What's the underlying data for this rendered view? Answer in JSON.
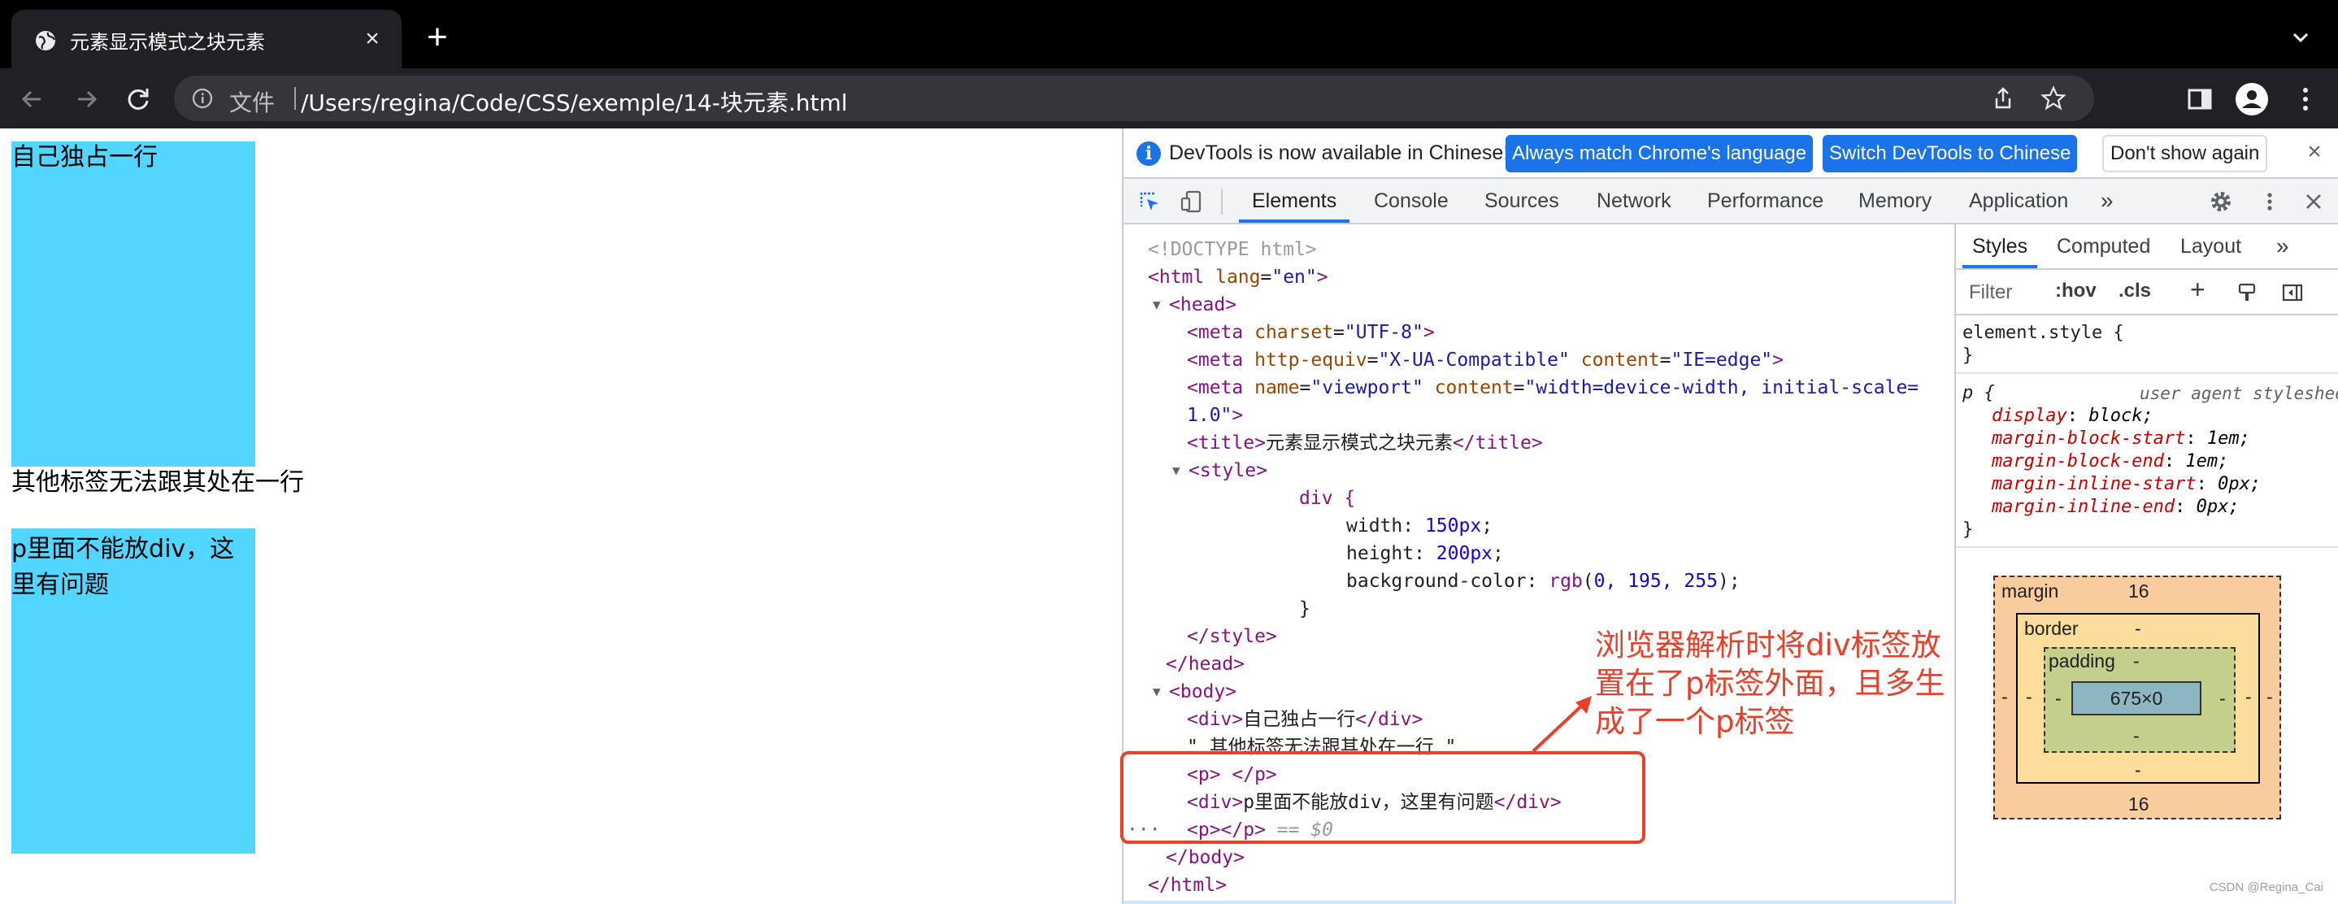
{
  "browser": {
    "tab_title": "元素显示模式之块元素",
    "omnibox_label": "文件",
    "url": "/Users/regina/Code/CSS/exemple/14-块元素.html"
  },
  "page": {
    "text1": "自己独占一行",
    "text2": "其他标签无法跟其处在一行",
    "text3_line1": "p里面不能放div，这",
    "text3_line2": "里有问题",
    "box_color": "#00c3ff"
  },
  "devtools": {
    "info_text": "DevTools is now available in Chinese!",
    "btn_match": "Always match Chrome's language",
    "btn_switch": "Switch DevTools to Chinese",
    "btn_dismiss": "Don't show again",
    "tabs": [
      "Elements",
      "Console",
      "Sources",
      "Network",
      "Performance",
      "Memory",
      "Application"
    ],
    "more": "»",
    "styles_tabs": [
      "Styles",
      "Computed",
      "Layout"
    ],
    "filter_placeholder": "Filter",
    "hov": ":hov",
    "cls": ".cls",
    "element_style": "element.style {",
    "close_brace": "}",
    "p_selector": "p {",
    "ua_label": "user agent stylesheet",
    "ua_props": [
      {
        "name": "display",
        "value": "block;"
      },
      {
        "name": "margin-block-start",
        "value": "1em;"
      },
      {
        "name": "margin-block-end",
        "value": "1em;"
      },
      {
        "name": "margin-inline-start",
        "value": "0px;"
      },
      {
        "name": "margin-inline-end",
        "value": "0px;"
      }
    ],
    "boxmodel": {
      "margin_label": "margin",
      "margin_top": "16",
      "margin_bottom": "16",
      "margin_side": "-",
      "border_label": "border",
      "border_val": "-",
      "padding_label": "padding",
      "padding_val": "-",
      "content": "675×0"
    }
  },
  "dom": {
    "doctype": "<!DOCTYPE html>",
    "html_open": "<html",
    "html_lang_attr": "lang",
    "html_lang_val": "\"en\"",
    "head": "<head>",
    "meta1_attr": "charset",
    "meta1_val": "\"UTF-8\"",
    "meta2_attr1": "http-equiv",
    "meta2_val1": "\"X-UA-Compatible\"",
    "meta2_attr2": "content",
    "meta2_val2": "\"IE=edge\"",
    "meta3_attr1": "name",
    "meta3_val1": "\"viewport\"",
    "meta3_attr2": "content",
    "meta3_val2": "\"width=device-width, initial-scale=",
    "meta3_val2b": "1.0\"",
    "title_text": "元素显示模式之块元素",
    "css_selector": "div {",
    "css_width": "width: ",
    "css_width_val": "150px",
    "css_height": "height: ",
    "css_height_val": "200px",
    "css_bg": "background-color: ",
    "css_bg_fn": "rgb",
    "css_bg_args": "0, 195, 255",
    "div1_text": "自己独占一行",
    "body_text": "\" 其他标签无法跟其处在一行 \"",
    "div2_text": "p里面不能放div，这里有问题",
    "selected_suffix": " == $0",
    "ellipsis": "···"
  },
  "annotation": {
    "text": "浏览器解析时将div标签放置在了p标签外面，且多生成了一个p标签",
    "color": "#e8402a"
  },
  "watermark": "CSDN @Regina_Cai"
}
